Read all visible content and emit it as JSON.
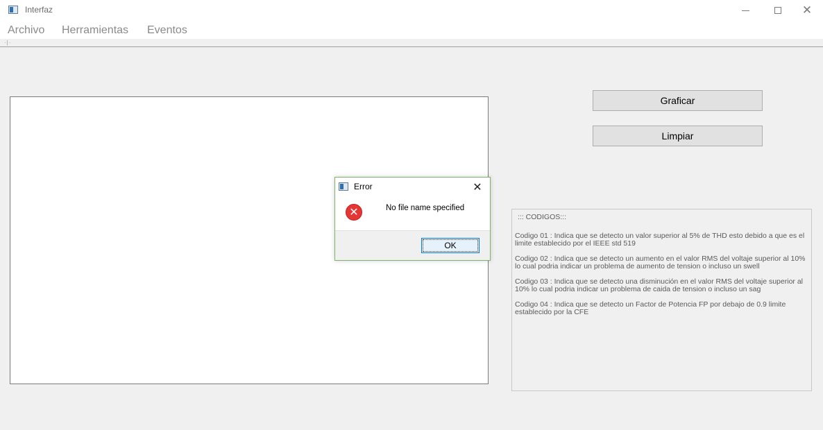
{
  "window": {
    "title": "Interfaz",
    "icon": "app-window-icon",
    "controls": {
      "minimize": "minimize-icon",
      "maximize": "maximize-icon",
      "close": "✕"
    }
  },
  "menu": {
    "items": [
      "Archivo",
      "Herramientas",
      "Eventos"
    ]
  },
  "buttons": {
    "graficar": "Graficar",
    "limpiar": "Limpiar"
  },
  "codes": {
    "header": "::: CODIGOS:::",
    "items": [
      "Codigo 01 : Indica que se detecto un valor superior al 5% de THD esto debido a que es el limite establecido por el IEEE std 519",
      "Codigo 02 : Indica que se detecto un aumento en el valor RMS del voltaje superior al 10% lo cual podria indicar un problema de aumento de tension o incluso un swell",
      "Codigo 03 : Indica que se detecto una disminución en el valor RMS del voltaje superior al 10% lo cual podria indicar un problema de caida de tension o incluso un sag",
      "Codigo 04 : Indica que se detecto un Factor de Potencia FP por debajo de 0.9 limite establecido por la CFE"
    ]
  },
  "dialog": {
    "title": "Error",
    "close": "✕",
    "icon": "error-icon",
    "error_glyph": "✕",
    "message": "No file name specified",
    "ok_label": "OK",
    "border_color": "#7fb26a"
  },
  "colors": {
    "background": "#f0f0f0",
    "ok_button_border": "#0078d7",
    "error_icon": "#e53535"
  }
}
